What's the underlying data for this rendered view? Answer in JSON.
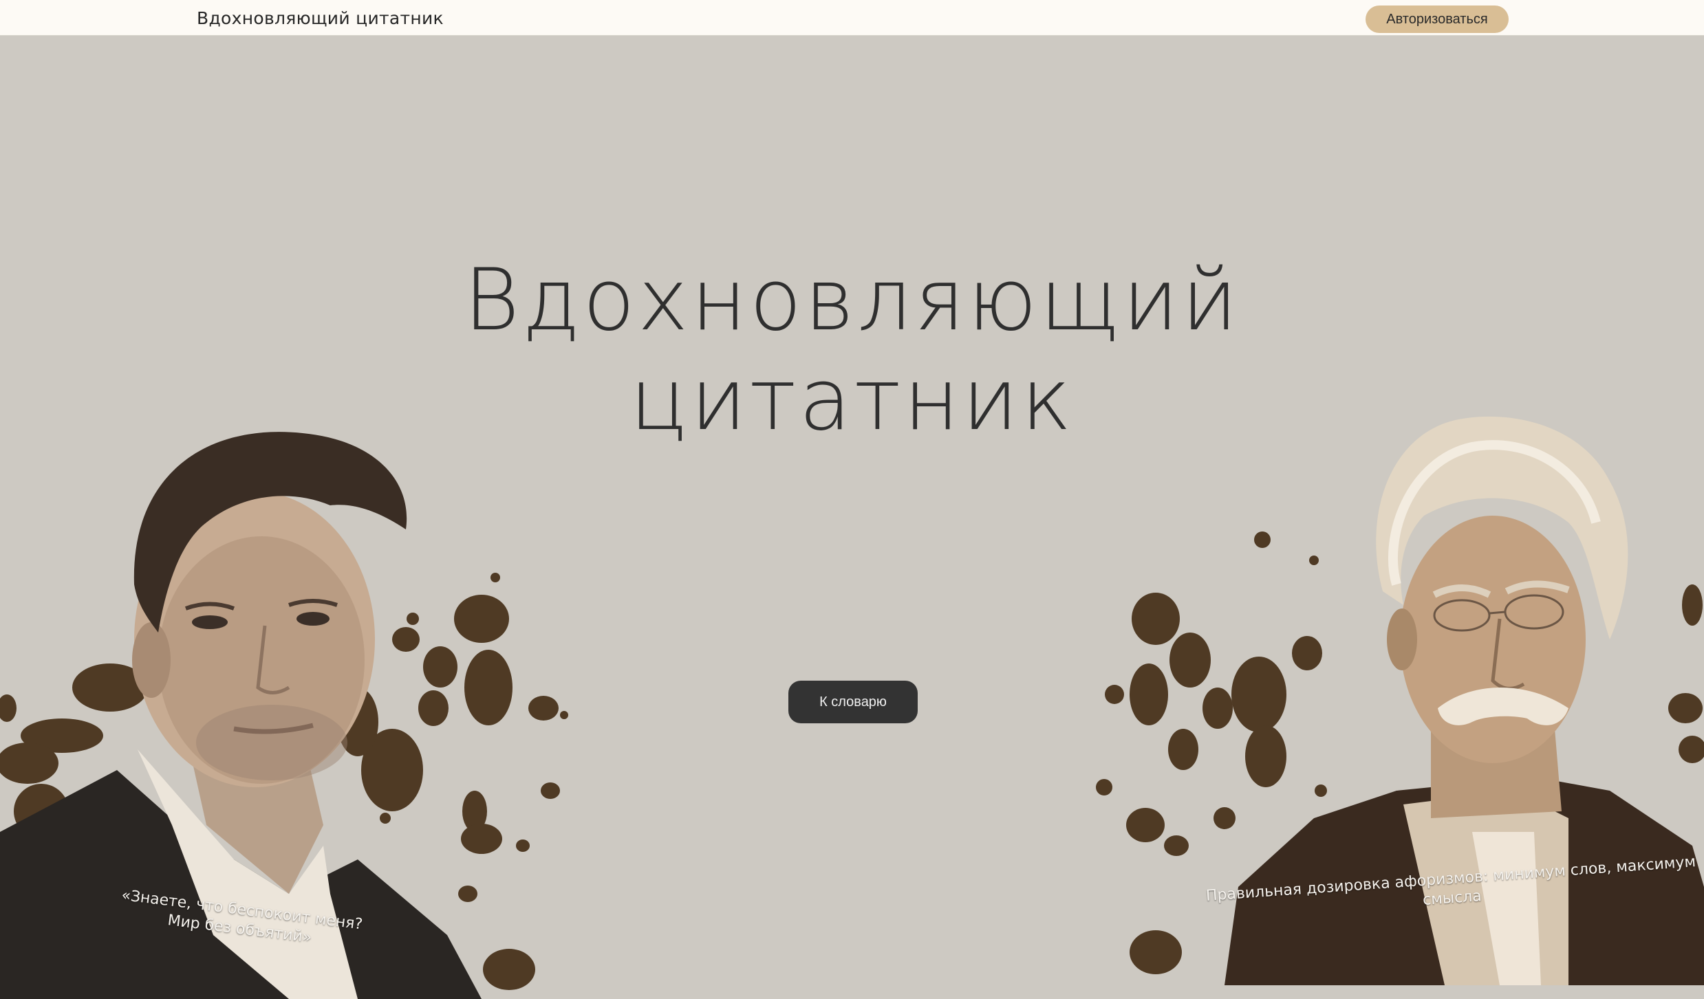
{
  "navbar": {
    "title": "Вдохновляющий цитатник",
    "login_label": "Авторизоваться"
  },
  "hero": {
    "title_line1": "Вдохновляющий",
    "title_line2": "цитатник",
    "cta_label": "К словарю"
  },
  "quotes": {
    "left_line1": "«Знаете, что беспокоит меня?",
    "left_line2": "Мир без объятий»",
    "right": "Правильная дозировка афоризмов: минимум слов, максимум смысла"
  },
  "colors": {
    "background": "#cdc9c2",
    "navbar": "#fdfaf5",
    "login_button": "#d9be95",
    "cta_button": "#333333",
    "ink_splatter": "#4f3a24"
  },
  "icons": {
    "left_portrait": "man-portrait-image",
    "right_portrait": "elderly-man-portrait-image"
  }
}
